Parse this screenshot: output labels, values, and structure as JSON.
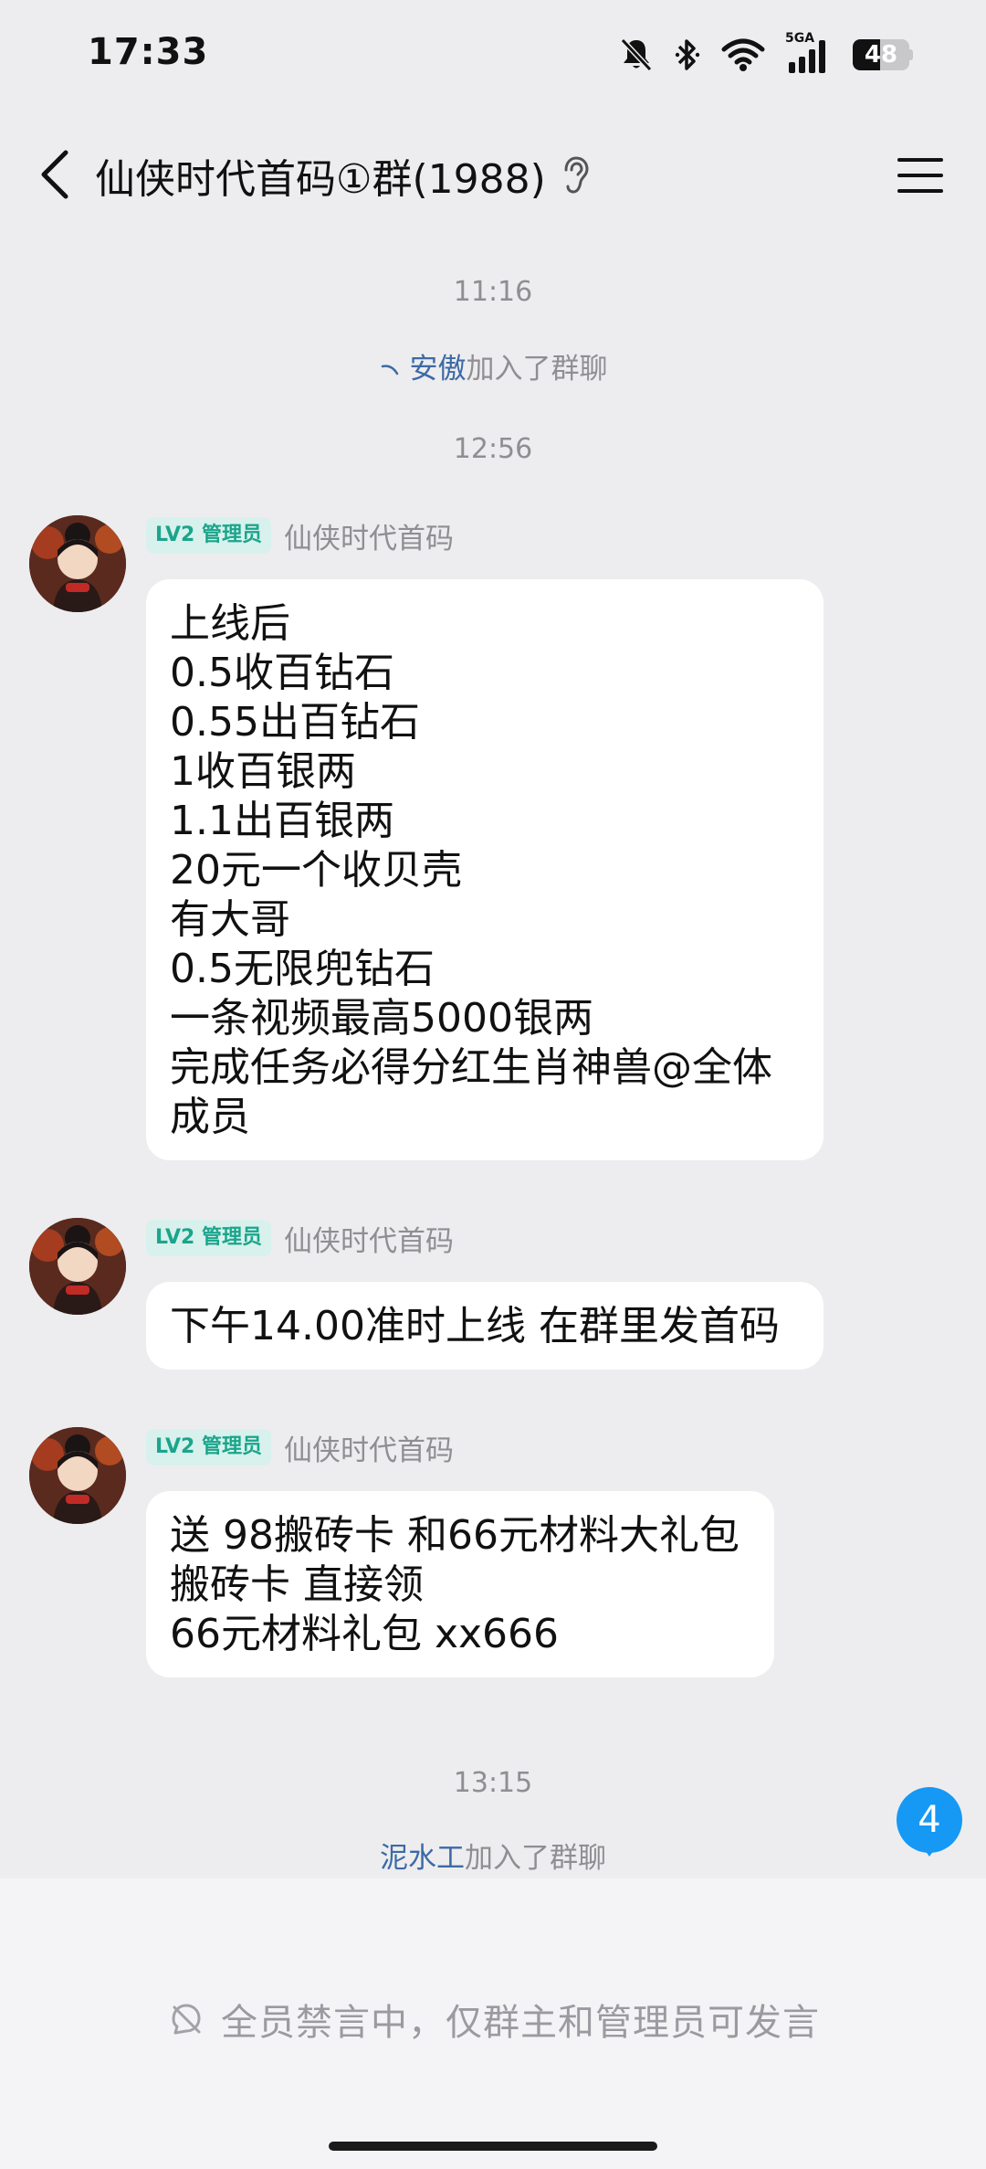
{
  "status_bar": {
    "time": "17:33",
    "network_label": "5GA",
    "battery": "48",
    "battery_level": 0.48,
    "icons": [
      "mute-bell-icon",
      "bluetooth-icon",
      "wifi-icon",
      "cellular-signal-icon",
      "battery-icon"
    ]
  },
  "nav": {
    "back_icon": "chevron-left-icon",
    "title": "仙侠时代首码①群(1988)",
    "ear_icon": "ear-icon",
    "menu_icon": "menu-icon"
  },
  "chat": {
    "ts1": "11:16",
    "sys1": {
      "name": "安傲",
      "text": "加入了群聊"
    },
    "ts2": "12:56",
    "messages": [
      {
        "badge": "LV2 管理员",
        "sender": "仙侠时代首码",
        "lines": [
          "上线后",
          "0.5收百钻石",
          "0.55出百钻石",
          "1收百银两",
          "1.1出百银两",
          "20元一个收贝壳",
          "有大哥",
          "0.5无限兜钻石",
          "一条视频最高5000银两",
          "完成任务必得分红生肖神兽@全体",
          "成员"
        ]
      },
      {
        "badge": "LV2 管理员",
        "sender": "仙侠时代首码",
        "lines": [
          "下午14.00准时上线  在群里发首码"
        ]
      },
      {
        "badge": "LV2 管理员",
        "sender": "仙侠时代首码",
        "lines": [
          "送 98搬砖卡 和66元材料大礼包",
          "搬砖卡 直接领",
          "66元材料礼包 xx666"
        ]
      }
    ],
    "ts3": "13:15",
    "sys2": {
      "name": "泥水工",
      "text": "加入了群聊"
    },
    "unread_count": "4"
  },
  "bottom": {
    "muted_text": "全员禁言中，仅群主和管理员可发言",
    "muted_icon": "no-speak-icon"
  },
  "colors": {
    "background": "#ededef",
    "badge_bg": "#d8f1ec",
    "badge_text": "#1aa58c",
    "link_name": "#3d6aa6",
    "unread": "#1698f5"
  }
}
